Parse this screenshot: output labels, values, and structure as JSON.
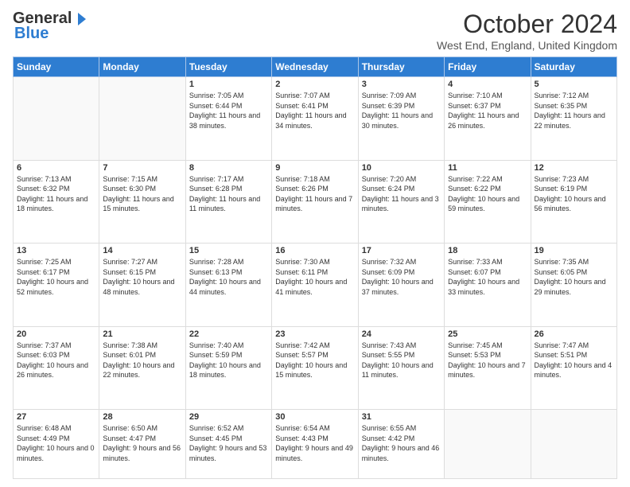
{
  "header": {
    "logo_line1": "General",
    "logo_line2": "Blue",
    "month": "October 2024",
    "location": "West End, England, United Kingdom"
  },
  "weekdays": [
    "Sunday",
    "Monday",
    "Tuesday",
    "Wednesday",
    "Thursday",
    "Friday",
    "Saturday"
  ],
  "weeks": [
    [
      {
        "day": "",
        "sunrise": "",
        "sunset": "",
        "daylight": ""
      },
      {
        "day": "",
        "sunrise": "",
        "sunset": "",
        "daylight": ""
      },
      {
        "day": "1",
        "sunrise": "Sunrise: 7:05 AM",
        "sunset": "Sunset: 6:44 PM",
        "daylight": "Daylight: 11 hours and 38 minutes."
      },
      {
        "day": "2",
        "sunrise": "Sunrise: 7:07 AM",
        "sunset": "Sunset: 6:41 PM",
        "daylight": "Daylight: 11 hours and 34 minutes."
      },
      {
        "day": "3",
        "sunrise": "Sunrise: 7:09 AM",
        "sunset": "Sunset: 6:39 PM",
        "daylight": "Daylight: 11 hours and 30 minutes."
      },
      {
        "day": "4",
        "sunrise": "Sunrise: 7:10 AM",
        "sunset": "Sunset: 6:37 PM",
        "daylight": "Daylight: 11 hours and 26 minutes."
      },
      {
        "day": "5",
        "sunrise": "Sunrise: 7:12 AM",
        "sunset": "Sunset: 6:35 PM",
        "daylight": "Daylight: 11 hours and 22 minutes."
      }
    ],
    [
      {
        "day": "6",
        "sunrise": "Sunrise: 7:13 AM",
        "sunset": "Sunset: 6:32 PM",
        "daylight": "Daylight: 11 hours and 18 minutes."
      },
      {
        "day": "7",
        "sunrise": "Sunrise: 7:15 AM",
        "sunset": "Sunset: 6:30 PM",
        "daylight": "Daylight: 11 hours and 15 minutes."
      },
      {
        "day": "8",
        "sunrise": "Sunrise: 7:17 AM",
        "sunset": "Sunset: 6:28 PM",
        "daylight": "Daylight: 11 hours and 11 minutes."
      },
      {
        "day": "9",
        "sunrise": "Sunrise: 7:18 AM",
        "sunset": "Sunset: 6:26 PM",
        "daylight": "Daylight: 11 hours and 7 minutes."
      },
      {
        "day": "10",
        "sunrise": "Sunrise: 7:20 AM",
        "sunset": "Sunset: 6:24 PM",
        "daylight": "Daylight: 11 hours and 3 minutes."
      },
      {
        "day": "11",
        "sunrise": "Sunrise: 7:22 AM",
        "sunset": "Sunset: 6:22 PM",
        "daylight": "Daylight: 10 hours and 59 minutes."
      },
      {
        "day": "12",
        "sunrise": "Sunrise: 7:23 AM",
        "sunset": "Sunset: 6:19 PM",
        "daylight": "Daylight: 10 hours and 56 minutes."
      }
    ],
    [
      {
        "day": "13",
        "sunrise": "Sunrise: 7:25 AM",
        "sunset": "Sunset: 6:17 PM",
        "daylight": "Daylight: 10 hours and 52 minutes."
      },
      {
        "day": "14",
        "sunrise": "Sunrise: 7:27 AM",
        "sunset": "Sunset: 6:15 PM",
        "daylight": "Daylight: 10 hours and 48 minutes."
      },
      {
        "day": "15",
        "sunrise": "Sunrise: 7:28 AM",
        "sunset": "Sunset: 6:13 PM",
        "daylight": "Daylight: 10 hours and 44 minutes."
      },
      {
        "day": "16",
        "sunrise": "Sunrise: 7:30 AM",
        "sunset": "Sunset: 6:11 PM",
        "daylight": "Daylight: 10 hours and 41 minutes."
      },
      {
        "day": "17",
        "sunrise": "Sunrise: 7:32 AM",
        "sunset": "Sunset: 6:09 PM",
        "daylight": "Daylight: 10 hours and 37 minutes."
      },
      {
        "day": "18",
        "sunrise": "Sunrise: 7:33 AM",
        "sunset": "Sunset: 6:07 PM",
        "daylight": "Daylight: 10 hours and 33 minutes."
      },
      {
        "day": "19",
        "sunrise": "Sunrise: 7:35 AM",
        "sunset": "Sunset: 6:05 PM",
        "daylight": "Daylight: 10 hours and 29 minutes."
      }
    ],
    [
      {
        "day": "20",
        "sunrise": "Sunrise: 7:37 AM",
        "sunset": "Sunset: 6:03 PM",
        "daylight": "Daylight: 10 hours and 26 minutes."
      },
      {
        "day": "21",
        "sunrise": "Sunrise: 7:38 AM",
        "sunset": "Sunset: 6:01 PM",
        "daylight": "Daylight: 10 hours and 22 minutes."
      },
      {
        "day": "22",
        "sunrise": "Sunrise: 7:40 AM",
        "sunset": "Sunset: 5:59 PM",
        "daylight": "Daylight: 10 hours and 18 minutes."
      },
      {
        "day": "23",
        "sunrise": "Sunrise: 7:42 AM",
        "sunset": "Sunset: 5:57 PM",
        "daylight": "Daylight: 10 hours and 15 minutes."
      },
      {
        "day": "24",
        "sunrise": "Sunrise: 7:43 AM",
        "sunset": "Sunset: 5:55 PM",
        "daylight": "Daylight: 10 hours and 11 minutes."
      },
      {
        "day": "25",
        "sunrise": "Sunrise: 7:45 AM",
        "sunset": "Sunset: 5:53 PM",
        "daylight": "Daylight: 10 hours and 7 minutes."
      },
      {
        "day": "26",
        "sunrise": "Sunrise: 7:47 AM",
        "sunset": "Sunset: 5:51 PM",
        "daylight": "Daylight: 10 hours and 4 minutes."
      }
    ],
    [
      {
        "day": "27",
        "sunrise": "Sunrise: 6:48 AM",
        "sunset": "Sunset: 4:49 PM",
        "daylight": "Daylight: 10 hours and 0 minutes."
      },
      {
        "day": "28",
        "sunrise": "Sunrise: 6:50 AM",
        "sunset": "Sunset: 4:47 PM",
        "daylight": "Daylight: 9 hours and 56 minutes."
      },
      {
        "day": "29",
        "sunrise": "Sunrise: 6:52 AM",
        "sunset": "Sunset: 4:45 PM",
        "daylight": "Daylight: 9 hours and 53 minutes."
      },
      {
        "day": "30",
        "sunrise": "Sunrise: 6:54 AM",
        "sunset": "Sunset: 4:43 PM",
        "daylight": "Daylight: 9 hours and 49 minutes."
      },
      {
        "day": "31",
        "sunrise": "Sunrise: 6:55 AM",
        "sunset": "Sunset: 4:42 PM",
        "daylight": "Daylight: 9 hours and 46 minutes."
      },
      {
        "day": "",
        "sunrise": "",
        "sunset": "",
        "daylight": ""
      },
      {
        "day": "",
        "sunrise": "",
        "sunset": "",
        "daylight": ""
      }
    ]
  ]
}
